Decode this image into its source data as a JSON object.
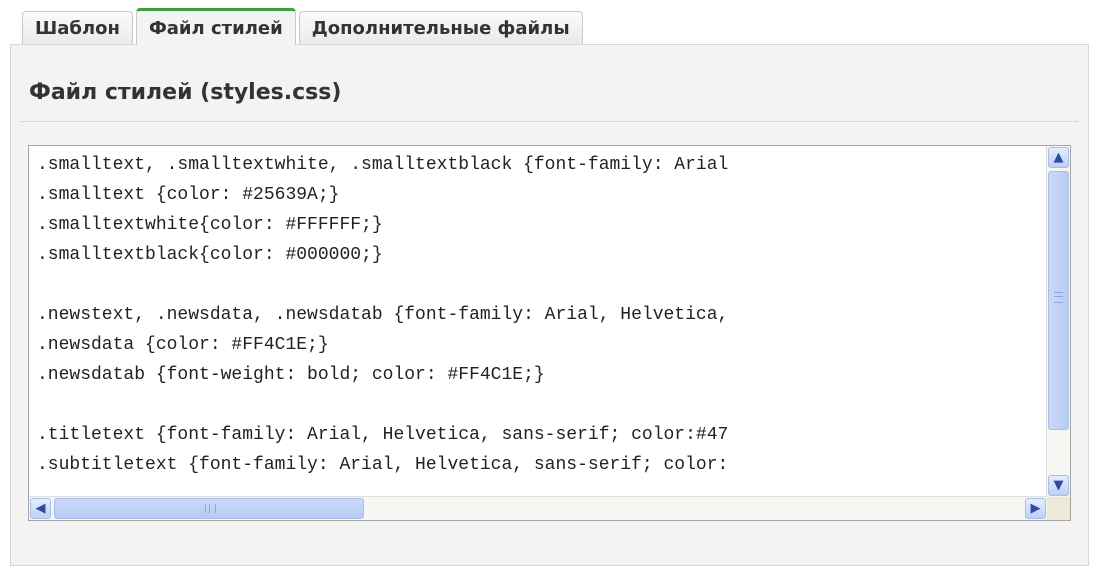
{
  "tabs": [
    {
      "label": "Шаблон",
      "active": false
    },
    {
      "label": "Файл стилей",
      "active": true
    },
    {
      "label": "Дополнительные файлы",
      "active": false
    }
  ],
  "heading": "Файл стилей (styles.css)",
  "editor": {
    "lines": [
      ".smalltext, .smalltextwhite, .smalltextblack {font-family: Arial",
      ".smalltext {color: #25639A;}",
      ".smalltextwhite{color: #FFFFFF;}",
      ".smalltextblack{color: #000000;}",
      "",
      ".newstext, .newsdata, .newsdatab {font-family: Arial, Helvetica,",
      ".newsdata {color: #FF4C1E;}",
      ".newsdatab {font-weight: bold; color: #FF4C1E;}",
      "",
      ".titletext {font-family: Arial, Helvetica, sans-serif; color:#47",
      ".subtitletext {font-family: Arial, Helvetica, sans-serif; color:"
    ]
  },
  "icons": {
    "scroll_up": "chevron-up-icon",
    "scroll_down": "chevron-down-icon",
    "scroll_left": "chevron-left-icon",
    "scroll_right": "chevron-right-icon"
  },
  "colors": {
    "active_tab_accent": "#3e9d3e",
    "scrollbar": "#bdd0f7"
  }
}
